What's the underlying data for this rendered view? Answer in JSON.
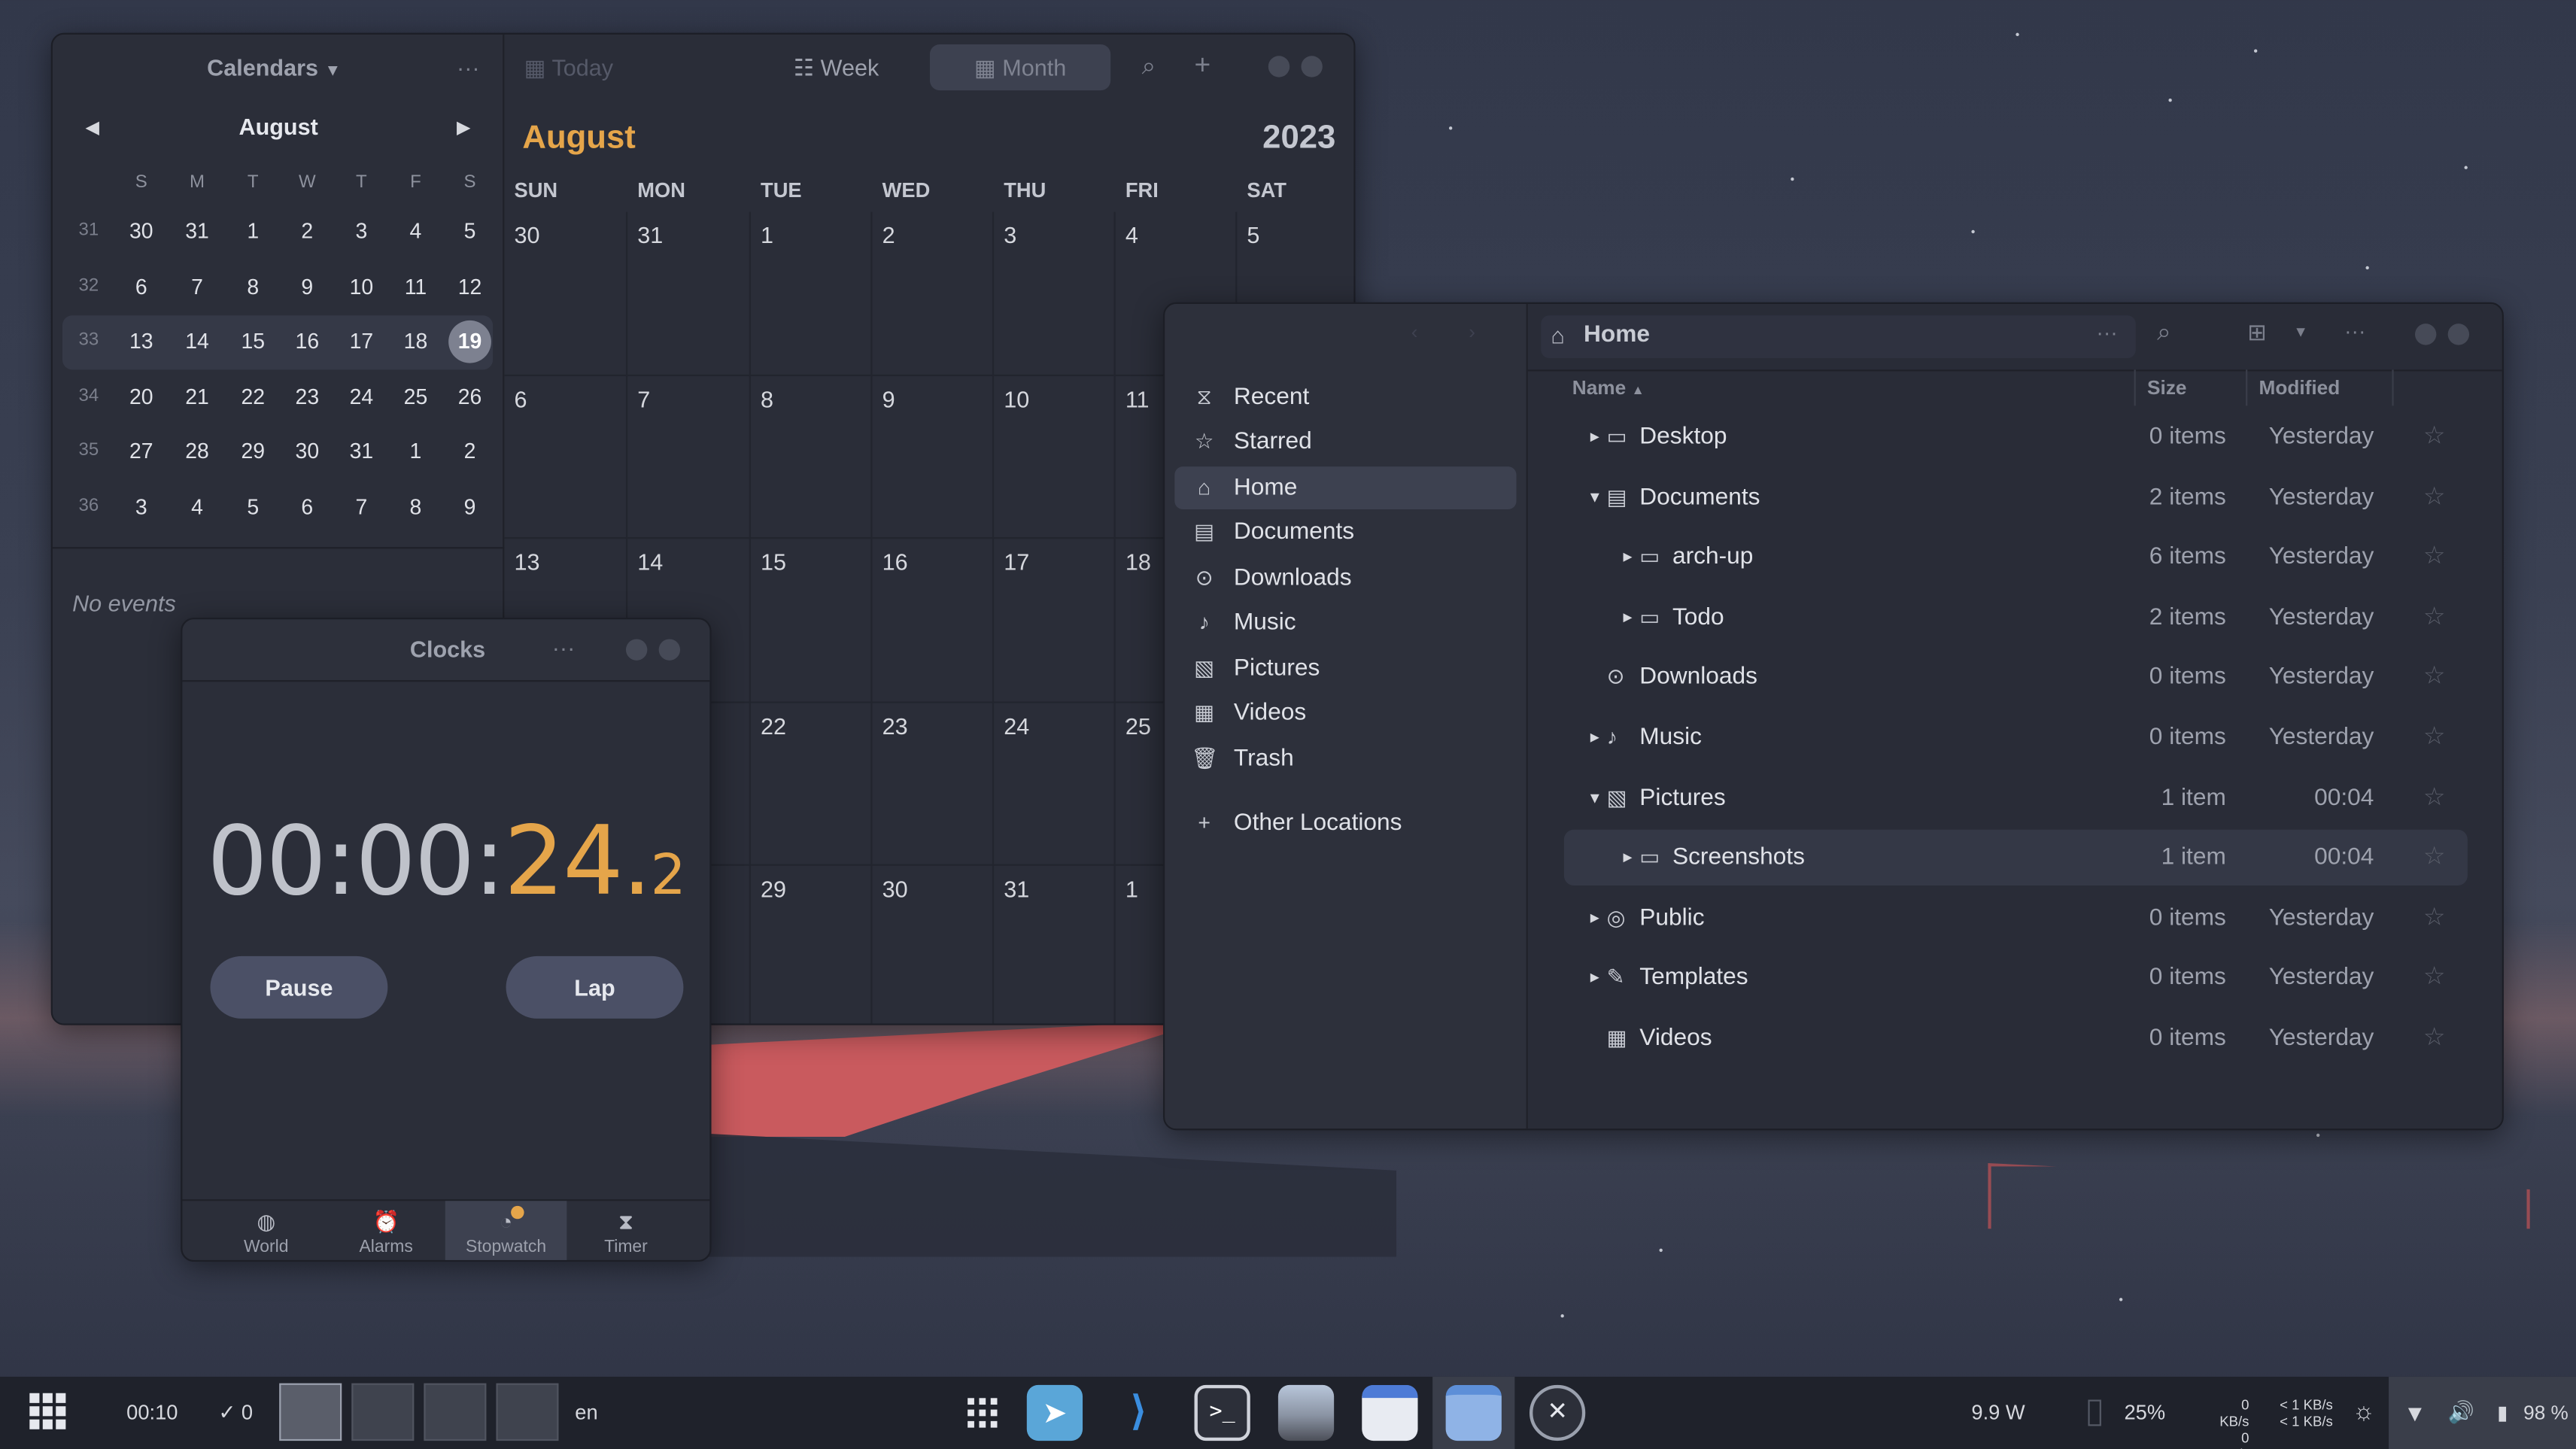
{
  "calendar": {
    "calendars_label": "Calendars",
    "menu": "···",
    "today": "Today",
    "view_week": "Week",
    "view_month": "Month",
    "mini_month": "August",
    "mini_days": [
      "S",
      "M",
      "T",
      "W",
      "T",
      "F",
      "S"
    ],
    "mini_weeks": [
      {
        "wk": "31",
        "days": [
          "30",
          "31",
          "1",
          "2",
          "3",
          "4",
          "5"
        ]
      },
      {
        "wk": "32",
        "days": [
          "6",
          "7",
          "8",
          "9",
          "10",
          "11",
          "12"
        ]
      },
      {
        "wk": "33",
        "days": [
          "13",
          "14",
          "15",
          "16",
          "17",
          "18",
          "19"
        ]
      },
      {
        "wk": "34",
        "days": [
          "20",
          "21",
          "22",
          "23",
          "24",
          "25",
          "26"
        ]
      },
      {
        "wk": "35",
        "days": [
          "27",
          "28",
          "29",
          "30",
          "31",
          "1",
          "2"
        ]
      },
      {
        "wk": "36",
        "days": [
          "3",
          "4",
          "5",
          "6",
          "7",
          "8",
          "9"
        ]
      }
    ],
    "today_day": "19",
    "no_events": "No events",
    "month_title": "August",
    "year": "2023",
    "day_headers": [
      "SUN",
      "MON",
      "TUE",
      "WED",
      "THU",
      "FRI",
      "SAT"
    ],
    "month_rows": [
      [
        "30",
        "31",
        "1",
        "2",
        "3",
        "4",
        "5"
      ],
      [
        "6",
        "7",
        "8",
        "9",
        "10",
        "11",
        ""
      ],
      [
        "13",
        "14",
        "15",
        "16",
        "17",
        "18",
        ""
      ],
      [
        "",
        "",
        "22",
        "23",
        "24",
        "25",
        ""
      ],
      [
        "",
        "",
        "29",
        "30",
        "31",
        "1",
        ""
      ]
    ],
    "accent": "#e5a54a"
  },
  "files": {
    "location": "Home",
    "sidebar": [
      {
        "label": "Recent",
        "icon": "⧖"
      },
      {
        "label": "Starred",
        "icon": "☆"
      },
      {
        "label": "Home",
        "icon": "⌂"
      },
      {
        "label": "Documents",
        "icon": "▤"
      },
      {
        "label": "Downloads",
        "icon": "⊙"
      },
      {
        "label": "Music",
        "icon": "♪"
      },
      {
        "label": "Pictures",
        "icon": "▧"
      },
      {
        "label": "Videos",
        "icon": "▦"
      },
      {
        "label": "Trash",
        "icon": "🗑"
      }
    ],
    "other_locations": "Other Locations",
    "columns": {
      "name": "Name",
      "size": "Size",
      "modified": "Modified"
    },
    "rows": [
      {
        "name": "Desktop",
        "icon": "▭",
        "expander": "▸",
        "indent": 0,
        "size": "0 items",
        "modified": "Yesterday"
      },
      {
        "name": "Documents",
        "icon": "▤",
        "expander": "▾",
        "indent": 0,
        "size": "2 items",
        "modified": "Yesterday"
      },
      {
        "name": "arch-up",
        "icon": "▭",
        "expander": "▸",
        "indent": 1,
        "size": "6 items",
        "modified": "Yesterday"
      },
      {
        "name": "Todo",
        "icon": "▭",
        "expander": "▸",
        "indent": 1,
        "size": "2 items",
        "modified": "Yesterday"
      },
      {
        "name": "Downloads",
        "icon": "⊙",
        "expander": "",
        "indent": 0,
        "size": "0 items",
        "modified": "Yesterday"
      },
      {
        "name": "Music",
        "icon": "♪",
        "expander": "▸",
        "indent": 0,
        "size": "0 items",
        "modified": "Yesterday"
      },
      {
        "name": "Pictures",
        "icon": "▧",
        "expander": "▾",
        "indent": 0,
        "size": "1 item",
        "modified": "00:04"
      },
      {
        "name": "Screenshots",
        "icon": "▭",
        "expander": "▸",
        "indent": 1,
        "size": "1 item",
        "modified": "00:04"
      },
      {
        "name": "Public",
        "icon": "◎",
        "expander": "▸",
        "indent": 0,
        "size": "0 items",
        "modified": "Yesterday"
      },
      {
        "name": "Templates",
        "icon": "✎",
        "expander": "▸",
        "indent": 0,
        "size": "0 items",
        "modified": "Yesterday"
      },
      {
        "name": "Videos",
        "icon": "▦",
        "expander": "",
        "indent": 0,
        "size": "0 items",
        "modified": "Yesterday"
      }
    ]
  },
  "clocks": {
    "title": "Clocks",
    "time_main": "00:00:",
    "time_sec": "24.",
    "time_tenths": "2",
    "pause": "Pause",
    "lap": "Lap",
    "tabs": [
      {
        "label": "World",
        "icon": "◍"
      },
      {
        "label": "Alarms",
        "icon": "⏰"
      },
      {
        "label": "Stopwatch",
        "icon": "◔"
      },
      {
        "label": "Timer",
        "icon": "⧗"
      }
    ]
  },
  "taskbar": {
    "time": "00:10",
    "tasks": "0",
    "lang": "en",
    "power": "9.9 W",
    "cpu": "25%",
    "disk_r": "0 KB/s",
    "disk_w": "0 KB/s",
    "net_r": "< 1 KB/s",
    "net_w": "< 1 KB/s",
    "battery": "98 %"
  }
}
